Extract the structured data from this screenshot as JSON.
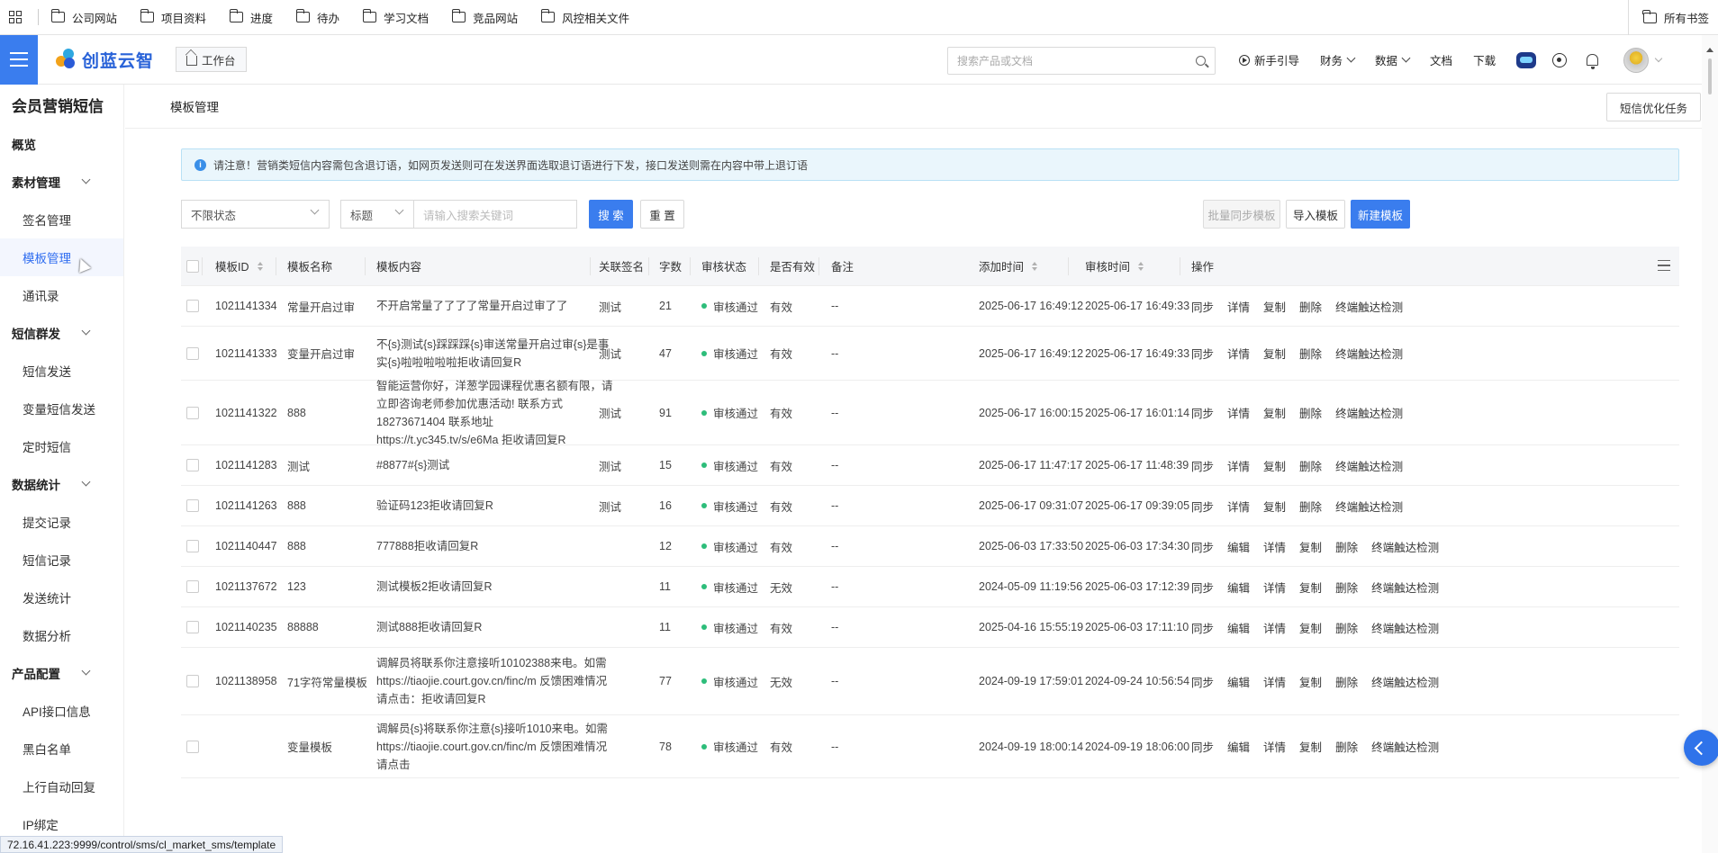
{
  "bookmarks": {
    "items": [
      "公司网站",
      "项目资料",
      "进度",
      "待办",
      "学习文档",
      "竞品网站",
      "风控相关文件"
    ],
    "all": "所有书签"
  },
  "topbar": {
    "logo": "创蓝云智",
    "workbench": "工作台",
    "search_placeholder": "搜索产品或文档",
    "nav": {
      "guide": "新手引导",
      "finance": "财务",
      "data": "数据",
      "docs": "文档",
      "download": "下载"
    }
  },
  "sidebar": {
    "title": "会员营销短信",
    "items": [
      {
        "label": "概览",
        "type": "group"
      },
      {
        "label": "素材管理",
        "type": "group",
        "expand": true
      },
      {
        "label": "签名管理",
        "type": "sub"
      },
      {
        "label": "模板管理",
        "type": "sub",
        "active": true
      },
      {
        "label": "通讯录",
        "type": "sub"
      },
      {
        "label": "短信群发",
        "type": "group",
        "expand": true
      },
      {
        "label": "短信发送",
        "type": "sub"
      },
      {
        "label": "变量短信发送",
        "type": "sub"
      },
      {
        "label": "定时短信",
        "type": "sub"
      },
      {
        "label": "数据统计",
        "type": "group",
        "expand": true
      },
      {
        "label": "提交记录",
        "type": "sub"
      },
      {
        "label": "短信记录",
        "type": "sub"
      },
      {
        "label": "发送统计",
        "type": "sub"
      },
      {
        "label": "数据分析",
        "type": "sub"
      },
      {
        "label": "产品配置",
        "type": "group",
        "expand": true
      },
      {
        "label": "API接口信息",
        "type": "sub"
      },
      {
        "label": "黑白名单",
        "type": "sub"
      },
      {
        "label": "上行自动回复",
        "type": "sub"
      },
      {
        "label": "IP绑定",
        "type": "sub"
      }
    ]
  },
  "page": {
    "title": "模板管理",
    "optimize_btn": "短信优化任务",
    "notice": "请注意！营销类短信内容需包含退订语，如网页发送则可在发送界面选取退订语进行下发，接口发送则需在内容中带上退订语"
  },
  "filters": {
    "status": "不限状态",
    "field": "标题",
    "keyword_placeholder": "请输入搜索关键词",
    "search": "搜 索",
    "reset": "重 置",
    "batch_sync": "批量同步模板",
    "import": "导入模板",
    "create": "新建模板"
  },
  "table": {
    "columns": [
      "模板ID",
      "模板名称",
      "模板内容",
      "关联签名",
      "字数",
      "审核状态",
      "是否有效",
      "备注",
      "添加时间",
      "审核时间",
      "操作"
    ],
    "rows": [
      {
        "id": "1021141334",
        "name": "常量开启过审",
        "content": "不开启常量了了了了常量开启过审了了",
        "sign": "测试",
        "count": "21",
        "status": "审核通过",
        "valid": "有效",
        "remark": "--",
        "added": "2025-06-17 16:49:12",
        "audited": "2025-06-17 16:49:33",
        "ops": [
          "同步",
          "详情",
          "复制",
          "删除",
          "终端触达检测"
        ]
      },
      {
        "id": "1021141333",
        "name": "变量开启过审",
        "content": "不{s}测试{s}踩踩踩{s}审送常量开启过审{s}是事实{s}啦啦啦啦啦拒收请回复R",
        "sign": "测试",
        "count": "47",
        "status": "审核通过",
        "valid": "有效",
        "remark": "--",
        "added": "2025-06-17 16:49:12",
        "audited": "2025-06-17 16:49:33",
        "ops": [
          "同步",
          "详情",
          "复制",
          "删除",
          "终端触达检测"
        ]
      },
      {
        "id": "1021141322",
        "name": "888",
        "content": "智能运营你好，洋葱学园课程优惠名额有限，请立即咨询老师参加优惠活动! 联系方式18273671404 联系地址 https://t.yc345.tv/s/e6Ma  拒收请回复R",
        "sign": "测试",
        "count": "91",
        "status": "审核通过",
        "valid": "有效",
        "remark": "--",
        "added": "2025-06-17 16:00:15",
        "audited": "2025-06-17 16:01:14",
        "ops": [
          "同步",
          "详情",
          "复制",
          "删除",
          "终端触达检测"
        ]
      },
      {
        "id": "1021141283",
        "name": "测试",
        "content": "#8877#{s}测试",
        "sign": "测试",
        "count": "15",
        "status": "审核通过",
        "valid": "有效",
        "remark": "--",
        "added": "2025-06-17 11:47:17",
        "audited": "2025-06-17 11:48:39",
        "ops": [
          "同步",
          "详情",
          "复制",
          "删除",
          "终端触达检测"
        ]
      },
      {
        "id": "1021141263",
        "name": "888",
        "content": "验证码123拒收请回复R",
        "sign": "测试",
        "count": "16",
        "status": "审核通过",
        "valid": "有效",
        "remark": "--",
        "added": "2025-06-17 09:31:07",
        "audited": "2025-06-17 09:39:05",
        "ops": [
          "同步",
          "详情",
          "复制",
          "删除",
          "终端触达检测"
        ]
      },
      {
        "id": "1021140447",
        "name": "888",
        "content": "777888拒收请回复R",
        "sign": "",
        "count": "12",
        "status": "审核通过",
        "valid": "有效",
        "remark": "--",
        "added": "2025-06-03 17:33:50",
        "audited": "2025-06-03 17:34:30",
        "ops": [
          "同步",
          "编辑",
          "详情",
          "复制",
          "删除",
          "终端触达检测"
        ]
      },
      {
        "id": "1021137672",
        "name": "123",
        "content": "测试模板2拒收请回复R",
        "sign": "",
        "count": "11",
        "status": "审核通过",
        "valid": "无效",
        "remark": "--",
        "added": "2024-05-09 11:19:56",
        "audited": "2025-06-03 17:12:39",
        "ops": [
          "同步",
          "编辑",
          "详情",
          "复制",
          "删除",
          "终端触达检测"
        ]
      },
      {
        "id": "1021140235",
        "name": "88888",
        "content": "测试888拒收请回复R",
        "sign": "",
        "count": "11",
        "status": "审核通过",
        "valid": "有效",
        "remark": "--",
        "added": "2025-04-16 15:55:19",
        "audited": "2025-06-03 17:11:10",
        "ops": [
          "同步",
          "编辑",
          "详情",
          "复制",
          "删除",
          "终端触达检测"
        ]
      },
      {
        "id": "1021138958",
        "name": "71字符常量模板",
        "content": "调解员将联系你注意接听10102388来电。如需 https://tiaojie.court.gov.cn/finc/m 反馈困难情况请点击：拒收请回复R",
        "sign": "",
        "count": "77",
        "status": "审核通过",
        "valid": "无效",
        "remark": "--",
        "added": "2024-09-19 17:59:01",
        "audited": "2024-09-24 10:56:54",
        "ops": [
          "同步",
          "编辑",
          "详情",
          "复制",
          "删除",
          "终端触达检测"
        ]
      },
      {
        "id": "",
        "name": "变量模板",
        "content": "调解员{s}将联系你注意{s}接听1010来电。如需 https://tiaojie.court.gov.cn/finc/m 反馈困难情况请点击",
        "sign": "",
        "count": "78",
        "status": "审核通过",
        "valid": "有效",
        "remark": "--",
        "added": "2024-09-19 18:00:14",
        "audited": "2024-09-19 18:06:00",
        "ops": [
          "同步",
          "编辑",
          "详情",
          "复制",
          "删除",
          "终端触达检测"
        ]
      }
    ]
  },
  "statusbar": "72.16.41.223:9999/control/sms/cl_market_sms/template"
}
